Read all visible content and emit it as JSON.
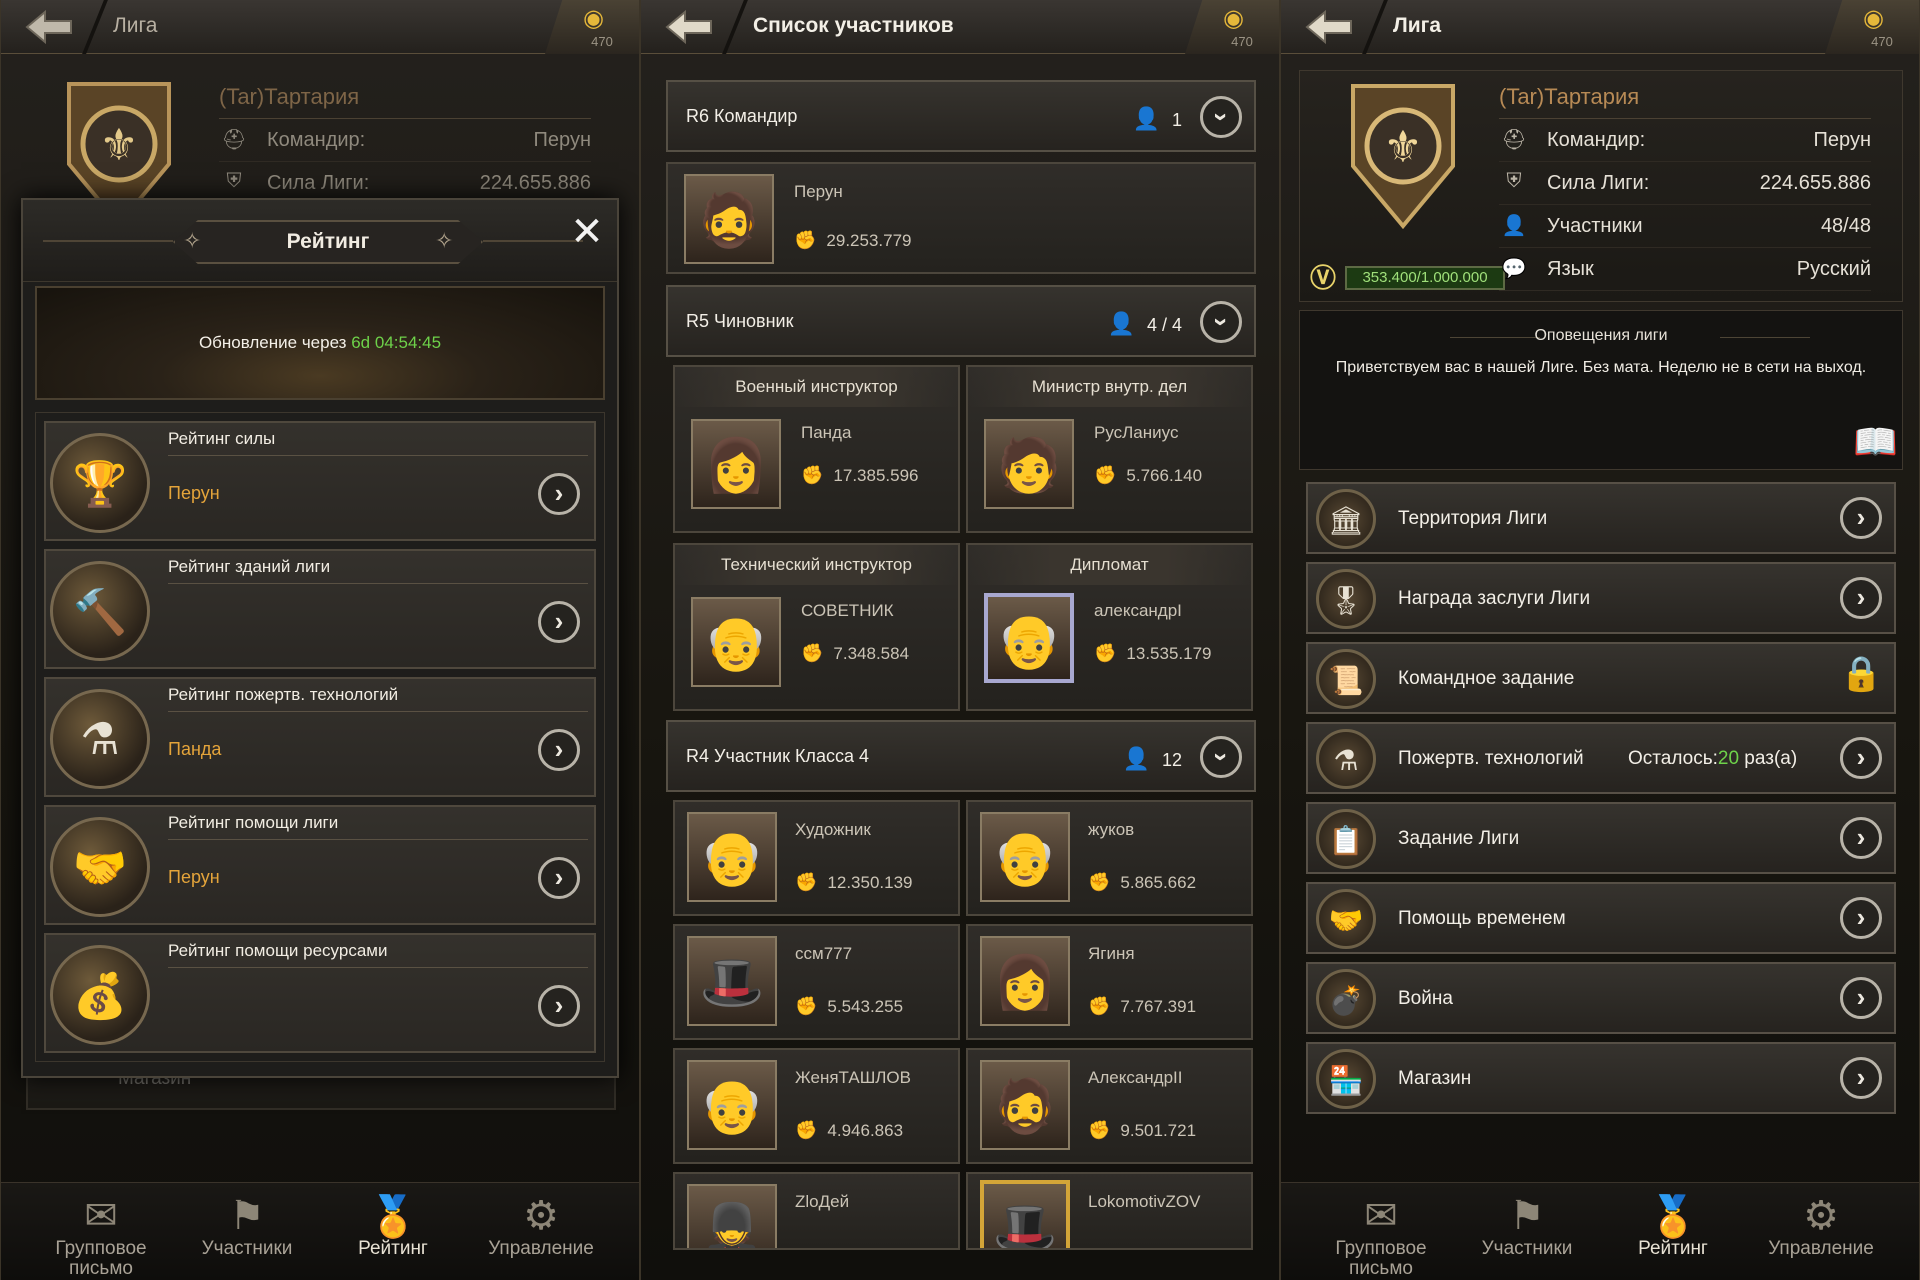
{
  "coins": "470",
  "guild": {
    "name": "(Tar)Тартария",
    "commander_label": "Командир:",
    "commander": "Перун",
    "power_label": "Сила Лиги:",
    "power": "224.655.886",
    "members_label": "Участники",
    "members": "48/48",
    "lang_label": "Язык",
    "lang": "Русский",
    "xp": "353.400/1.000.000"
  },
  "panel1": {
    "title": "Лига",
    "bg_shop_label": "Магазин",
    "overlay": {
      "title": "Рейтинг",
      "update_prefix": "Обновление через",
      "update_days": "6d",
      "update_time": "04:54:45",
      "items": [
        {
          "title": "Рейтинг силы",
          "value": "Перун",
          "icon": "trophy-icon"
        },
        {
          "title": "Рейтинг зданий лиги",
          "value": "",
          "icon": "hammer-icon"
        },
        {
          "title": "Рейтинг пожертв. технологий",
          "value": "Панда",
          "icon": "flask-icon"
        },
        {
          "title": "Рейтинг помощи лиги",
          "value": "Перун",
          "icon": "handshake-icon"
        },
        {
          "title": "Рейтинг помощи ресурсами",
          "value": "",
          "icon": "coins-hand-icon"
        }
      ]
    }
  },
  "panel2": {
    "title": "Список участников",
    "r6": {
      "label": "R6 Командир",
      "count": "1"
    },
    "r6_member": {
      "name": "Перун",
      "power": "29.253.779"
    },
    "r5": {
      "label": "R5 Чиновник",
      "count": "4 / 4"
    },
    "r5_members": [
      {
        "role": "Военный инструктор",
        "name": "Панда",
        "power": "17.385.596"
      },
      {
        "role": "Министр внутр. дел",
        "name": "РусЛаниус",
        "power": "5.766.140"
      },
      {
        "role": "Технический инструктор",
        "name": "СОВЕТНИК",
        "power": "7.348.584"
      },
      {
        "role": "Дипломат",
        "name": "александрI",
        "power": "13.535.179"
      }
    ],
    "r4": {
      "label": "R4 Участник Класса 4",
      "count": "12"
    },
    "r4_members": [
      {
        "name": "Художник",
        "power": "12.350.139"
      },
      {
        "name": "жуков",
        "power": "5.865.662"
      },
      {
        "name": "ccм777",
        "power": "5.543.255"
      },
      {
        "name": "Ягиня",
        "power": "7.767.391"
      },
      {
        "name": "ЖеняТАШЛОВ",
        "power": "4.946.863"
      },
      {
        "name": "АлександрII",
        "power": "9.501.721"
      },
      {
        "name": "ZloДей",
        "power": ""
      },
      {
        "name": "LokomotivZOV",
        "power": ""
      }
    ]
  },
  "panel3": {
    "title": "Лига",
    "notice_title": "Оповещения лиги",
    "notice_text": "Приветствуем вас в нашей Лиге. Без мата. Неделю не в сети на выход.",
    "menu": [
      {
        "label": "Территория Лиги",
        "icon": "castle-icon"
      },
      {
        "label": "Награда заслуги Лиги",
        "icon": "medal-icon"
      },
      {
        "label": "Командное задание",
        "icon": "scroll-icon",
        "locked": true
      },
      {
        "label": "Пожертв. технологий",
        "icon": "flask-icon",
        "extra_prefix": "Осталось:",
        "extra_num": "20",
        "extra_suffix": " раз(а)"
      },
      {
        "label": "Задание Лиги",
        "icon": "document-icon"
      },
      {
        "label": "Помощь временем",
        "icon": "handshake-icon"
      },
      {
        "label": "Война",
        "icon": "cannon-icon"
      },
      {
        "label": "Магазин",
        "icon": "shop-icon"
      }
    ]
  },
  "nav": [
    {
      "label": "Групповое письмо",
      "icon": "mail-icon"
    },
    {
      "label": "Участники",
      "icon": "members-icon"
    },
    {
      "label": "Рейтинг",
      "icon": "medal-icon"
    },
    {
      "label": "Управление",
      "icon": "manage-icon"
    }
  ],
  "colors": {
    "accent_orange": "#e4a43a",
    "guild_name": "#b78a55",
    "highlight_green": "#6ed24a"
  }
}
